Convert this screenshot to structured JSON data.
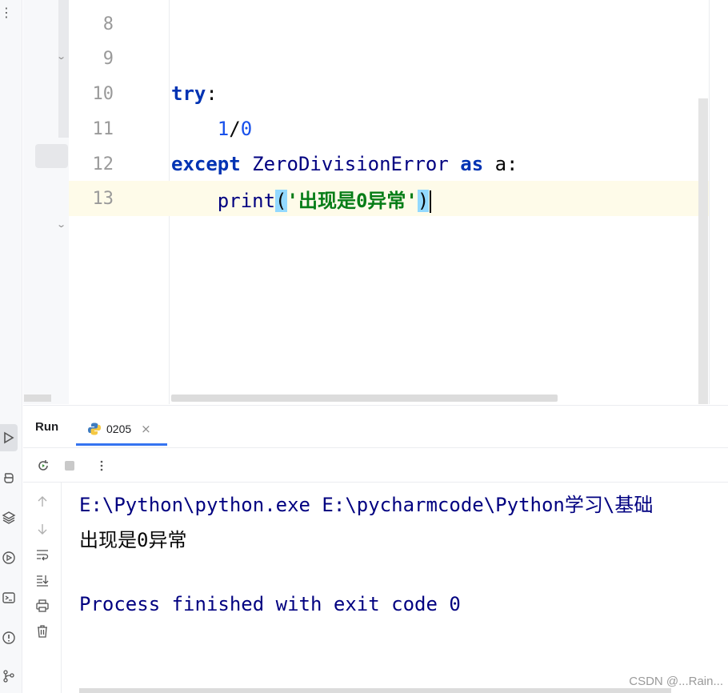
{
  "editor": {
    "lines": [
      {
        "num": "8"
      },
      {
        "num": "9"
      },
      {
        "num": "10",
        "kw": "try",
        "rest": ":"
      },
      {
        "num": "11",
        "indent": "    ",
        "n1": "1",
        "op": "/",
        "n2": "0"
      },
      {
        "num": "12",
        "kw": "except",
        "cls": " ZeroDivisionError ",
        "kw2": "as",
        "rest": " a:"
      },
      {
        "num": "13",
        "indent": "    ",
        "fn": "print",
        "lp": "(",
        "str": "'出现是0异常'",
        "rp": ")"
      }
    ]
  },
  "run_panel": {
    "title": "Run",
    "tab_label": "0205",
    "tab_close": "×",
    "console": {
      "command": "E:\\Python\\python.exe E:\\pycharmcode\\Python学习\\基础",
      "output": "出现是0异常",
      "process": "Process finished with exit code 0"
    }
  },
  "watermark": "CSDN @...Rain...",
  "icons": {
    "strip": [
      "run-icon",
      "python-packages-icon",
      "layers-icon",
      "services-icon",
      "terminal-icon",
      "problems-icon",
      "git-icon"
    ],
    "toolbar": [
      "rerun-icon",
      "stop-icon",
      "more-icon"
    ],
    "side": [
      "up-arrow-icon",
      "down-arrow-icon",
      "soft-wrap-icon",
      "scroll-to-end-icon",
      "print-icon",
      "trash-icon"
    ]
  },
  "colors": {
    "keyword": "#0033b3",
    "number": "#1750eb",
    "string": "#067d17",
    "current_line": "#fefbe9",
    "brace_match": "#93d9ff",
    "console_text": "#000080"
  }
}
